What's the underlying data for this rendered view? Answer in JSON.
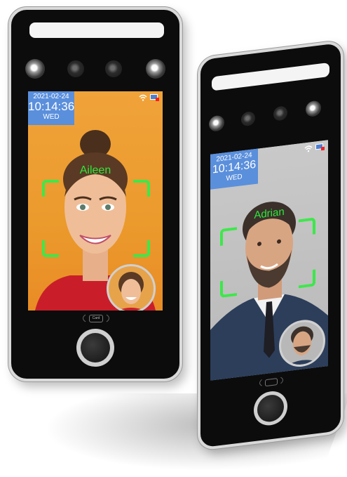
{
  "device_left": {
    "date": "2021-02-24",
    "time": "10:14:36",
    "weekday": "WED",
    "recognized_name": "Aileen",
    "nfc_label": "Card"
  },
  "device_right": {
    "date": "2021-02-24",
    "time": "10:14:36",
    "weekday": "WED",
    "recognized_name": "Adrian"
  },
  "colors": {
    "frame": "#0c0c0c",
    "date_box": "#5a8fdc",
    "face_frame": "#3ce84a",
    "left_background": "#eb9a2c",
    "right_background": "#c0c0c0"
  }
}
